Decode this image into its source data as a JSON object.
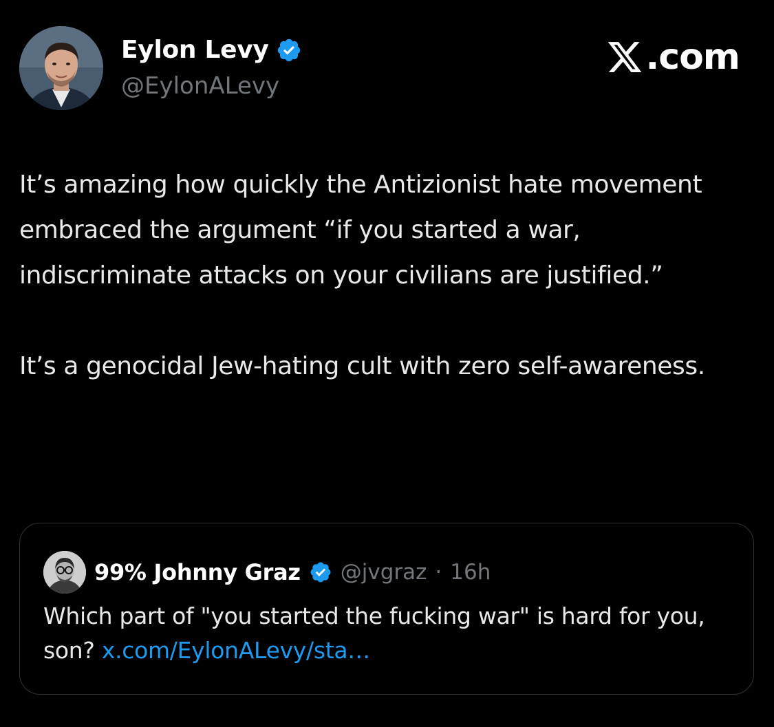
{
  "author": {
    "name": "Eylon Levy",
    "handle": "@EylonALevy",
    "verified": true
  },
  "brand": {
    "label": ".com"
  },
  "post": {
    "paragraphs": [
      "It’s amazing how quickly the Antizionist hate movement embraced the argument “if you started a war, indiscriminate attacks on your civilians are justified.”",
      "It’s a genocidal Jew-hating cult with zero self-awareness."
    ]
  },
  "quote": {
    "name": "99% Johnny Graz",
    "handle": "@jvgraz",
    "separator": "·",
    "time": "16h",
    "text": "Which part of \"you started the fucking war\" is hard for you, son? ",
    "link_text": "x.com/EylonALevy/sta…"
  },
  "colors": {
    "background": "#000000",
    "text": "#e7e9ea",
    "muted": "#71767b",
    "link": "#1d9bf0",
    "verified": "#1d9bf0",
    "border": "#2f3336"
  },
  "icons": {
    "verified": "verified-badge-icon",
    "brand": "x-logo-icon"
  }
}
